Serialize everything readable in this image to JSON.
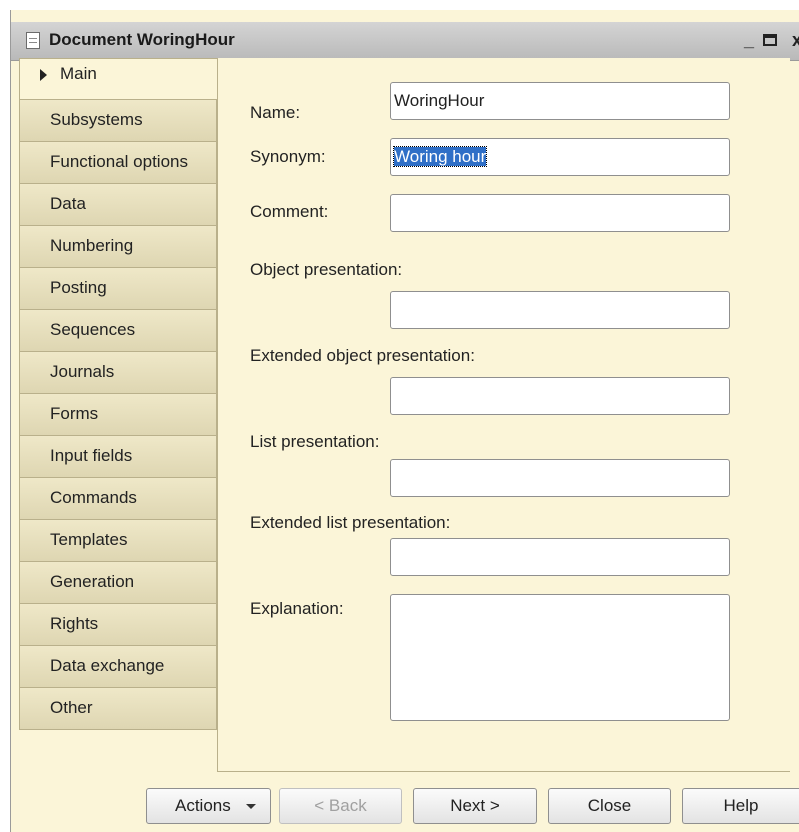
{
  "window": {
    "title": "Document WoringHour",
    "minimize": "_",
    "close": "x"
  },
  "tabs": [
    {
      "label": "Main",
      "active": true
    },
    {
      "label": "Subsystems"
    },
    {
      "label": "Functional options"
    },
    {
      "label": "Data"
    },
    {
      "label": "Numbering"
    },
    {
      "label": "Posting"
    },
    {
      "label": "Sequences"
    },
    {
      "label": "Journals"
    },
    {
      "label": "Forms"
    },
    {
      "label": "Input fields"
    },
    {
      "label": "Commands"
    },
    {
      "label": "Templates"
    },
    {
      "label": "Generation"
    },
    {
      "label": "Rights"
    },
    {
      "label": "Data exchange"
    },
    {
      "label": "Other"
    }
  ],
  "form": {
    "name_label": "Name:",
    "name_value": "WoringHour",
    "synonym_label": "Synonym:",
    "synonym_value": "Woring hour",
    "comment_label": "Comment:",
    "comment_value": "",
    "object_presentation_label": "Object presentation:",
    "object_presentation_value": "",
    "extended_object_presentation_label": "Extended object presentation:",
    "extended_object_presentation_value": "",
    "list_presentation_label": "List presentation:",
    "list_presentation_value": "",
    "extended_list_presentation_label": "Extended list presentation:",
    "extended_list_presentation_value": "",
    "explanation_label": "Explanation:",
    "explanation_value": ""
  },
  "buttons": {
    "actions": "Actions",
    "back": "< Back",
    "next": "Next >",
    "close": "Close",
    "help": "Help"
  }
}
